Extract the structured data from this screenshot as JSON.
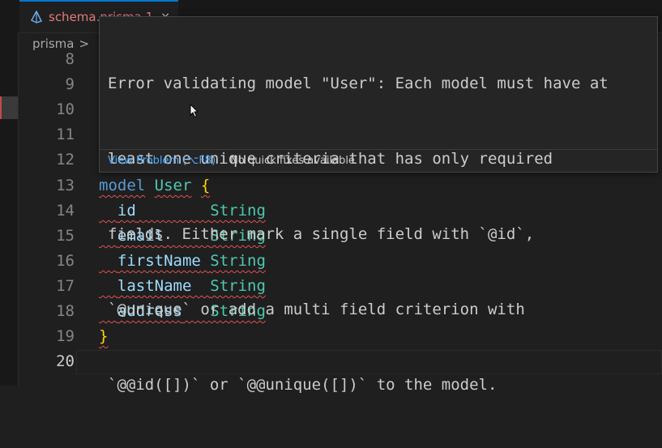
{
  "tab": {
    "filename": "schema.prisma 1",
    "close_glyph": "×"
  },
  "breadcrumb": {
    "folder": "prisma",
    "separator": ">"
  },
  "hover": {
    "message_lines": [
      "Error validating model \"User\": Each model must have at",
      "least one unique criteria that has only required",
      "fields. Either mark a single field with `@id`,",
      "`@unique` or add a multi field criterion with",
      "`@@id([])` or `@@unique([])` to the model."
    ],
    "view_problem": "View Problem (⌥F8)",
    "no_fixes": "No quick fixes available"
  },
  "editor": {
    "line_numbers": [
      "8",
      "9",
      "10",
      "11",
      "12",
      "13",
      "14",
      "15",
      "16",
      "17",
      "18",
      "19",
      "20"
    ],
    "model_keyword": "model",
    "model_name": "User",
    "open_brace": "{",
    "close_brace": "}",
    "fields": [
      {
        "name": "id",
        "pad": "        ",
        "type": "String"
      },
      {
        "name": "email",
        "pad": "     ",
        "type": "String"
      },
      {
        "name": "firstName",
        "pad": " ",
        "type": "String"
      },
      {
        "name": "lastName",
        "pad": "  ",
        "type": "String"
      },
      {
        "name": "address",
        "pad": "   ",
        "type": "String"
      }
    ]
  },
  "colors": {
    "error": "#e05252",
    "link": "#4daafc",
    "keyword": "#569cd6",
    "type": "#4ec9b0",
    "field": "#9cdcfe",
    "brace": "#ffd700"
  }
}
